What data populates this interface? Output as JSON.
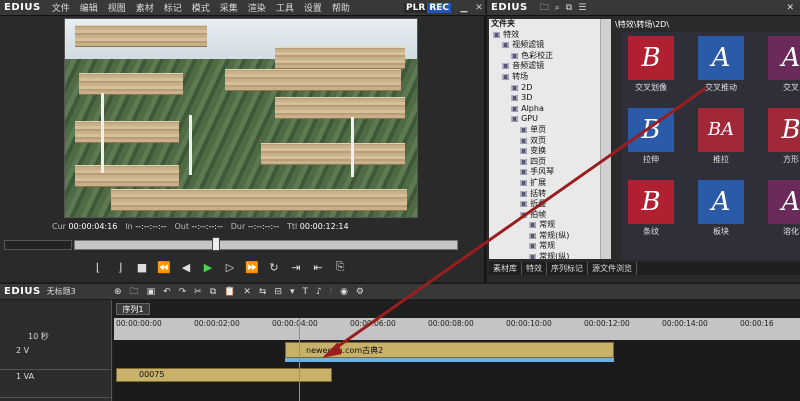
{
  "player": {
    "logo": "EDIUS",
    "menu": [
      "文件",
      "编辑",
      "视图",
      "素材",
      "标记",
      "模式",
      "采集",
      "渲染",
      "工具",
      "设置",
      "帮助"
    ],
    "plr": "PLR",
    "rec": "REC",
    "timecodes": {
      "cur_label": "Cur",
      "cur": "00:00:04:16",
      "in_label": "In",
      "in": "--:--:--:--",
      "out_label": "Out",
      "out": "--:--:--:--",
      "dur_label": "Dur",
      "dur": "--:--:--:--",
      "ttl_label": "Ttl",
      "ttl": "00:00:12:14"
    }
  },
  "library": {
    "logo": "EDIUS",
    "tree_header": "文件夹",
    "tree": [
      {
        "label": "特效",
        "indent": 0
      },
      {
        "label": "视频滤镜",
        "indent": 1
      },
      {
        "label": "色彩校正",
        "indent": 2
      },
      {
        "label": "音频滤镜",
        "indent": 1
      },
      {
        "label": "转场",
        "indent": 1
      },
      {
        "label": "2D",
        "indent": 2
      },
      {
        "label": "3D",
        "indent": 2
      },
      {
        "label": "Alpha",
        "indent": 2
      },
      {
        "label": "GPU",
        "indent": 2
      },
      {
        "label": "单页",
        "indent": 3
      },
      {
        "label": "双页",
        "indent": 3
      },
      {
        "label": "变换",
        "indent": 3
      },
      {
        "label": "四页",
        "indent": 3
      },
      {
        "label": "手风琴",
        "indent": 3
      },
      {
        "label": "扩展",
        "indent": 3
      },
      {
        "label": "括转",
        "indent": 3
      },
      {
        "label": "折叠",
        "indent": 3
      },
      {
        "label": "拍帧",
        "indent": 3
      },
      {
        "label": "常规",
        "indent": 4
      },
      {
        "label": "常规(纵)",
        "indent": 4
      },
      {
        "label": "常规",
        "indent": 4
      },
      {
        "label": "常规(纵)",
        "indent": 4
      }
    ],
    "preview_path": "\\特效\\转场\\2D\\",
    "thumbs": [
      {
        "letter": "B",
        "label": "交叉划像",
        "bg": "#b02030",
        "fg": "#ffffff"
      },
      {
        "letter": "A",
        "label": "交叉推动",
        "bg": "#2a5aa8",
        "fg": "#ffffff"
      },
      {
        "letter": "A",
        "label": "交叉",
        "bg": "#6a2a5a",
        "fg": "#ffffff"
      },
      {
        "letter": "B",
        "label": "拉伸",
        "bg": "#2a5aa8",
        "fg": "#ffffff"
      },
      {
        "letter": "BA",
        "label": "推拉",
        "bg": "#a02838",
        "fg": "#ffffff"
      },
      {
        "letter": "B",
        "label": "方形",
        "bg": "#a02838",
        "fg": "#ffffff"
      },
      {
        "letter": "B",
        "label": "条纹",
        "bg": "#b02030",
        "fg": "#ffffff"
      },
      {
        "letter": "A",
        "label": "板块",
        "bg": "#2a5aa8",
        "fg": "#ffffff"
      },
      {
        "letter": "A",
        "label": "溶化",
        "bg": "#6a2a5a",
        "fg": "#ffffff"
      }
    ],
    "tabs": [
      "素材库",
      "特效",
      "序列标记",
      "源文件浏览"
    ]
  },
  "timeline": {
    "logo": "EDIUS",
    "project": "无标题3",
    "sequence_tab": "序列1",
    "ruler_ticks": [
      "00:00:00:00",
      "00:00:02:00",
      "00:00:04:00",
      "00:00:06:00",
      "00:00:08:00",
      "00:00:10:00",
      "00:00:12:00",
      "00:00:14:00",
      "00:00:16"
    ],
    "track_2": {
      "name": "2 V",
      "clip_label": "newegen.com古典2"
    },
    "track_1": {
      "name": "1 VA",
      "clip_label": "00075"
    },
    "zoom_value": "10 秒"
  },
  "colors": {
    "accent_blue": "#2255bb",
    "arrow": "#9a1e1e"
  }
}
